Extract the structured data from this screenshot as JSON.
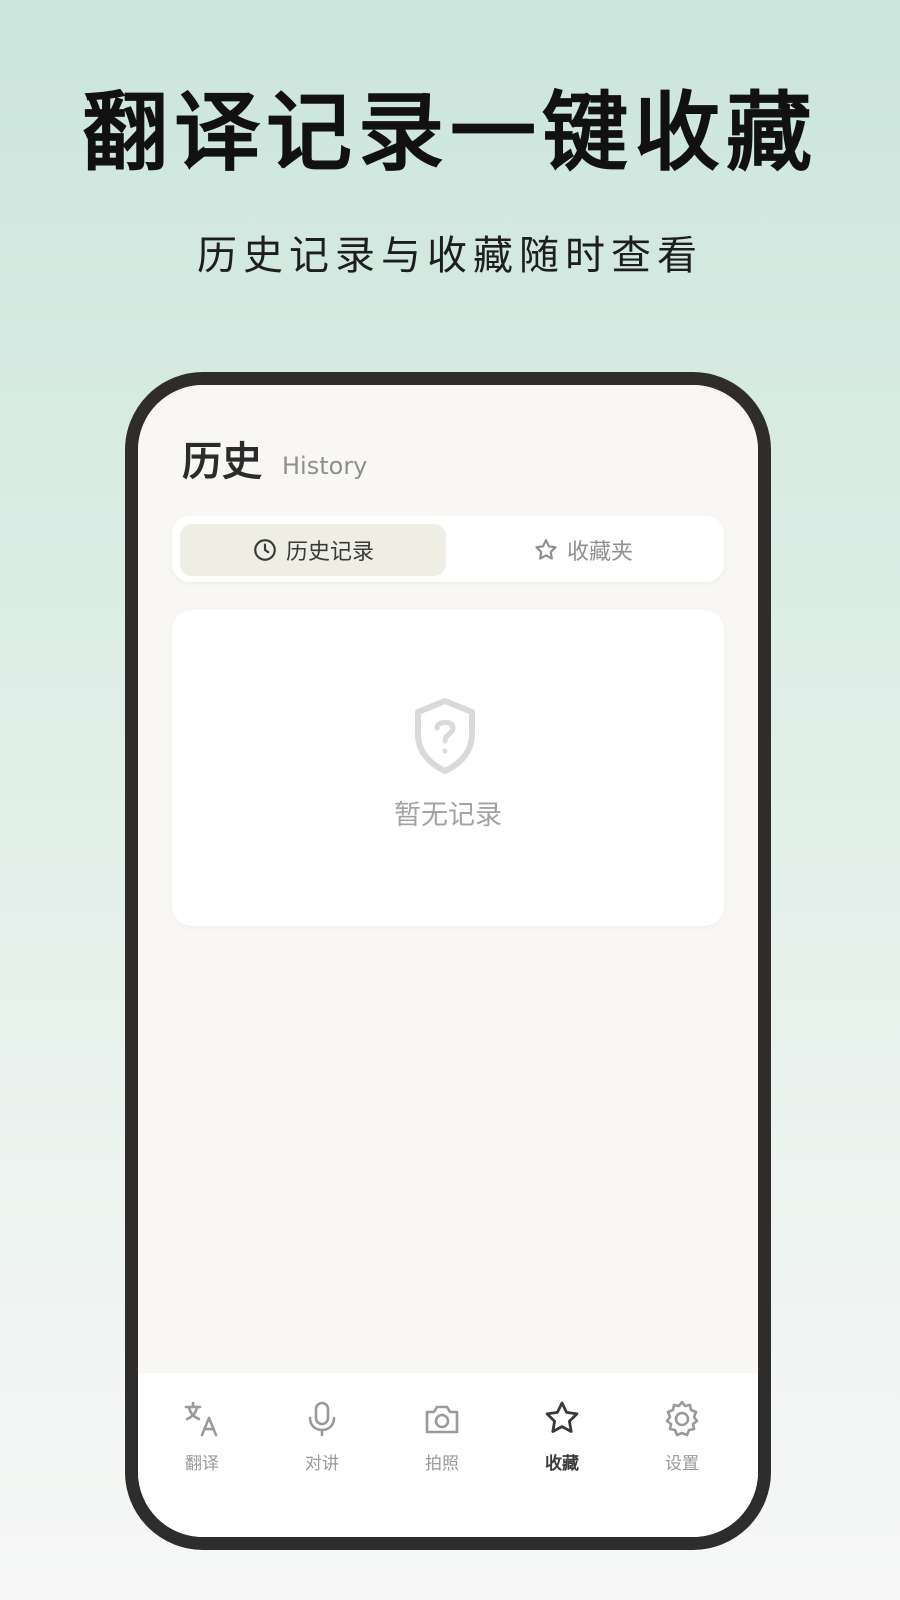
{
  "promo": {
    "headline": "翻译记录一键收藏",
    "subline": "历史记录与收藏随时查看"
  },
  "page": {
    "title": "历史",
    "title_en": "History"
  },
  "tabs": [
    {
      "label": "历史记录",
      "icon": "clock-icon",
      "active": true
    },
    {
      "label": "收藏夹",
      "icon": "star-icon",
      "active": false
    }
  ],
  "empty_state": {
    "icon": "shield-question-icon",
    "text": "暂无记录"
  },
  "nav": [
    {
      "label": "翻译",
      "icon": "translate-icon",
      "active": false
    },
    {
      "label": "对讲",
      "icon": "microphone-icon",
      "active": false
    },
    {
      "label": "拍照",
      "icon": "camera-icon",
      "active": false
    },
    {
      "label": "收藏",
      "icon": "star-icon",
      "active": true
    },
    {
      "label": "设置",
      "icon": "gear-icon",
      "active": false
    }
  ],
  "colors": {
    "accent": "#3a3a38",
    "inactive": "#9a9a9a",
    "active_tab_bg": "#eeeee4",
    "phone_frame": "#2f2d2c"
  }
}
